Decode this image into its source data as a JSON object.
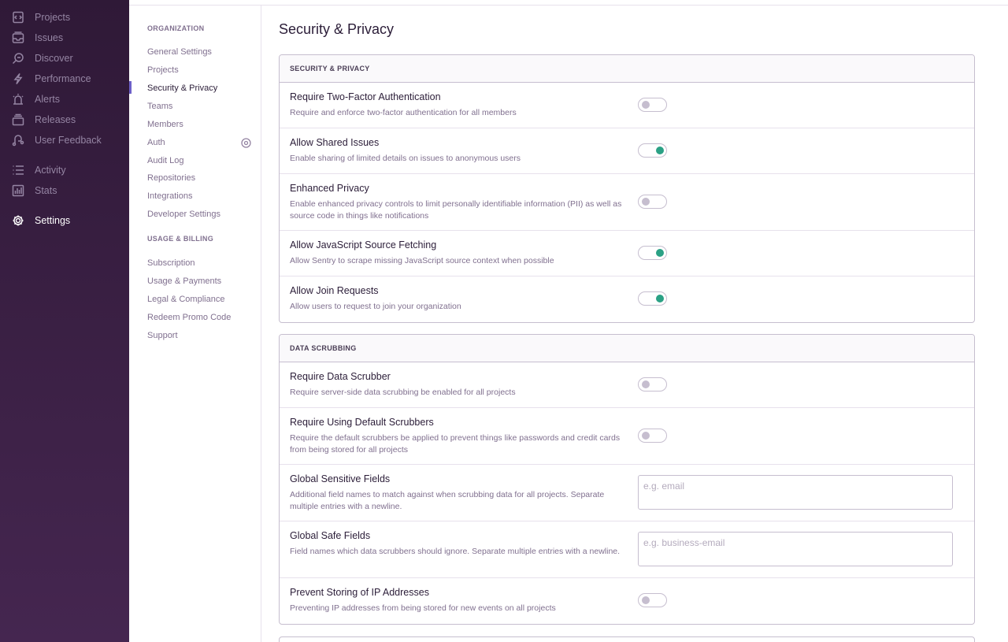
{
  "sidebar": {
    "items": [
      {
        "label": "Projects",
        "icon": "projects-icon"
      },
      {
        "label": "Issues",
        "icon": "issues-icon"
      },
      {
        "label": "Discover",
        "icon": "discover-icon"
      },
      {
        "label": "Performance",
        "icon": "performance-icon"
      },
      {
        "label": "Alerts",
        "icon": "alerts-icon"
      },
      {
        "label": "Releases",
        "icon": "releases-icon"
      },
      {
        "label": "User Feedback",
        "icon": "user-feedback-icon"
      },
      {
        "label": "Activity",
        "icon": "activity-icon"
      },
      {
        "label": "Stats",
        "icon": "stats-icon"
      },
      {
        "label": "Settings",
        "icon": "settings-icon"
      }
    ]
  },
  "subnav": {
    "organization_heading": "ORGANIZATION",
    "organization_items": [
      "General Settings",
      "Projects",
      "Security & Privacy",
      "Teams",
      "Members",
      "Auth",
      "Audit Log",
      "Repositories",
      "Integrations",
      "Developer Settings"
    ],
    "billing_heading": "USAGE & BILLING",
    "billing_items": [
      "Subscription",
      "Usage & Payments",
      "Legal & Compliance",
      "Redeem Promo Code",
      "Support"
    ]
  },
  "page": {
    "title": "Security & Privacy"
  },
  "security_panel": {
    "header": "SECURITY & PRIVACY",
    "rows": [
      {
        "label": "Require Two-Factor Authentication",
        "help": "Require and enforce two-factor authentication for all members",
        "enabled": false
      },
      {
        "label": "Allow Shared Issues",
        "help": "Enable sharing of limited details on issues to anonymous users",
        "enabled": true
      },
      {
        "label": "Enhanced Privacy",
        "help": "Enable enhanced privacy controls to limit personally identifiable information (PII) as well as source code in things like notifications",
        "enabled": false
      },
      {
        "label": "Allow JavaScript Source Fetching",
        "help": "Allow Sentry to scrape missing JavaScript source context when possible",
        "enabled": true
      },
      {
        "label": "Allow Join Requests",
        "help": "Allow users to request to join your organization",
        "enabled": true
      }
    ]
  },
  "scrubbing_panel": {
    "header": "DATA SCRUBBING",
    "rows": [
      {
        "label": "Require Data Scrubber",
        "help": "Require server-side data scrubbing be enabled for all projects",
        "enabled": false
      },
      {
        "label": "Require Using Default Scrubbers",
        "help": "Require the default scrubbers be applied to prevent things like passwords and credit cards from being stored for all projects",
        "enabled": false
      },
      {
        "label": "Global Sensitive Fields",
        "help": "Additional field names to match against when scrubbing data for all projects. Separate multiple entries with a newline.",
        "placeholder": "e.g. email"
      },
      {
        "label": "Global Safe Fields",
        "help": "Field names which data scrubbers should ignore. Separate multiple entries with a newline.",
        "placeholder": "e.g. business-email"
      },
      {
        "label": "Prevent Storing of IP Addresses",
        "help": "Preventing IP addresses from being stored for new events on all projects",
        "enabled": false
      }
    ]
  }
}
